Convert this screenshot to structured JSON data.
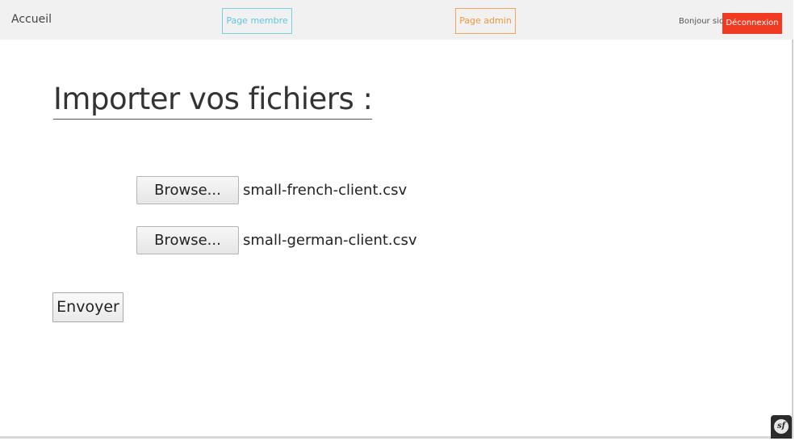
{
  "navbar": {
    "brand": "Accueil",
    "member_link": "Page membre",
    "admin_link": "Page admin",
    "greeting": "Bonjour sio",
    "logout": "Déconnexion"
  },
  "main": {
    "title": "Importer vos fichiers :",
    "files": [
      {
        "button_label": "Browse...",
        "file_name": "small-french-client.csv"
      },
      {
        "button_label": "Browse...",
        "file_name": "small-german-client.csv"
      }
    ],
    "submit_label": "Envoyer"
  },
  "toolbar": {
    "icon": "symfony-logo-icon",
    "icon_text": "sf"
  },
  "colors": {
    "navbar_bg": "#f1f1f1",
    "member_accent": "#5ec6dc",
    "admin_accent": "#f0963c",
    "logout_bg": "#f03b22"
  }
}
